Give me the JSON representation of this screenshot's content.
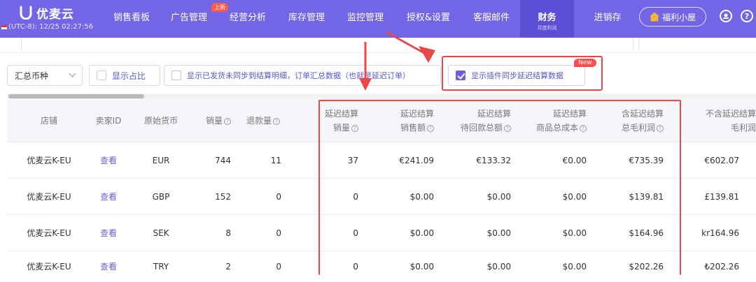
{
  "app": {
    "logo_text": "优麦云",
    "clock": "(UTC-8): 12/25 02:27:56",
    "accent": "#7266e6"
  },
  "nav": {
    "items": [
      {
        "label": "销售看板"
      },
      {
        "label": "广告管理",
        "badge": "上新"
      },
      {
        "label": "经营分析"
      },
      {
        "label": "库存管理"
      },
      {
        "label": "监控管理"
      },
      {
        "label": "授权&设置"
      },
      {
        "label": "客服邮件"
      },
      {
        "label": "财务",
        "sub": "月度利润"
      },
      {
        "label": "进销存"
      }
    ],
    "welfare": "福利小屋",
    "icons": [
      "support-icon",
      "help-icon"
    ],
    "help_glyph": "?"
  },
  "filters": {
    "currency_select": "汇总币种",
    "show_ratio": "显示占比",
    "show_unsynced": "显示已发货未同步到结算明细，订单汇总数据（也就是延迟订单）",
    "show_plugin_sync": "显示插件同步延迟结算数据",
    "new_badge": "New",
    "show_ratio_checked": false,
    "show_unsynced_checked": false,
    "show_plugin_sync_checked": true
  },
  "table": {
    "headers": {
      "store": "店铺",
      "seller_id": "卖家ID",
      "currency": "原始货币",
      "sales_qty": "销量",
      "refund_qty": "退款量",
      "delay_qty_1": "延迟结算",
      "delay_qty_2": "销量",
      "delay_sales_1": "延迟结算",
      "delay_sales_2": "销售额",
      "delay_pending_1": "延迟结算",
      "delay_pending_2": "待回款总额",
      "delay_cost_1": "延迟结算",
      "delay_cost_2": "商品总成本",
      "with_delay_1": "含延迟结算",
      "with_delay_2": "总毛利润",
      "without_delay_1": "不含延迟结算",
      "without_delay_2": "毛利润"
    },
    "rows": [
      {
        "store": "优麦云K-EU",
        "seller_id": "查看",
        "currency": "EUR",
        "sales_qty": "744",
        "refund_qty": "11",
        "delay_qty": "37",
        "delay_sales": "€241.09",
        "delay_pending": "€133.32",
        "delay_cost": "€0.00",
        "with_delay": "€735.39",
        "without_delay": "€602.07"
      },
      {
        "store": "优麦云K-EU",
        "seller_id": "查看",
        "currency": "GBP",
        "sales_qty": "152",
        "refund_qty": "0",
        "delay_qty": "0",
        "delay_sales": "$0.00",
        "delay_pending": "$0.00",
        "delay_cost": "$0.00",
        "with_delay": "$139.81",
        "without_delay": "£139.81"
      },
      {
        "store": "优麦云K-EU",
        "seller_id": "查看",
        "currency": "SEK",
        "sales_qty": "8",
        "refund_qty": "0",
        "delay_qty": "0",
        "delay_sales": "$0.00",
        "delay_pending": "$0.00",
        "delay_cost": "$0.00",
        "with_delay": "$164.96",
        "without_delay": "kr164.96"
      },
      {
        "store": "优麦云K-EU",
        "seller_id": "查看",
        "currency": "TRY",
        "sales_qty": "2",
        "refund_qty": "0",
        "delay_qty": "0",
        "delay_sales": "$0.00",
        "delay_pending": "$0.00",
        "delay_cost": "$0.00",
        "with_delay": "$202.26",
        "without_delay": "₺202.26"
      }
    ]
  }
}
